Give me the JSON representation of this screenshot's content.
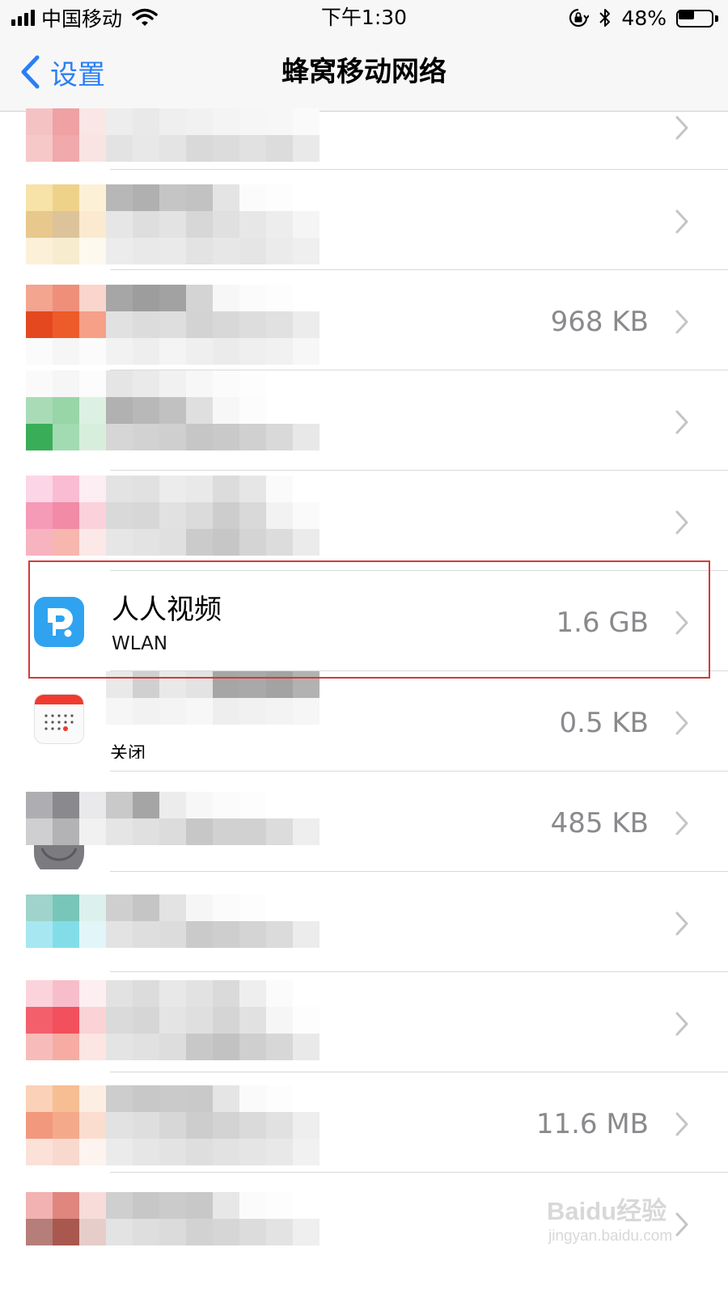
{
  "status_bar": {
    "carrier": "中国移动",
    "time": "下午1:30",
    "battery_percent": "48%",
    "battery_level": 0.48
  },
  "nav": {
    "back_label": "设置",
    "title": "蜂窝移动网络"
  },
  "colors": {
    "accent": "#2a7ff5",
    "highlight_border": "#d33a3a",
    "secondary_text": "#8a8a8e",
    "app_icon_blue": "#2fa3f0"
  },
  "rows": [
    {
      "value": ""
    },
    {
      "value": ""
    },
    {
      "value": "968 KB"
    },
    {
      "value": ""
    },
    {
      "value": ""
    },
    {
      "name": "人人视频",
      "subtitle": "WLAN",
      "value": "1.6 GB",
      "icon": "renren-video-icon"
    },
    {
      "subtitle_partial": "关闭",
      "value": "0.5 KB",
      "icon": "calendar-icon"
    },
    {
      "value": "485 KB"
    },
    {
      "value": ""
    },
    {
      "value": ""
    },
    {
      "value": "11.6 MB"
    },
    {
      "value": ""
    }
  ],
  "watermark": {
    "main": "Baidu经验",
    "url": "jingyan.baidu.com"
  }
}
